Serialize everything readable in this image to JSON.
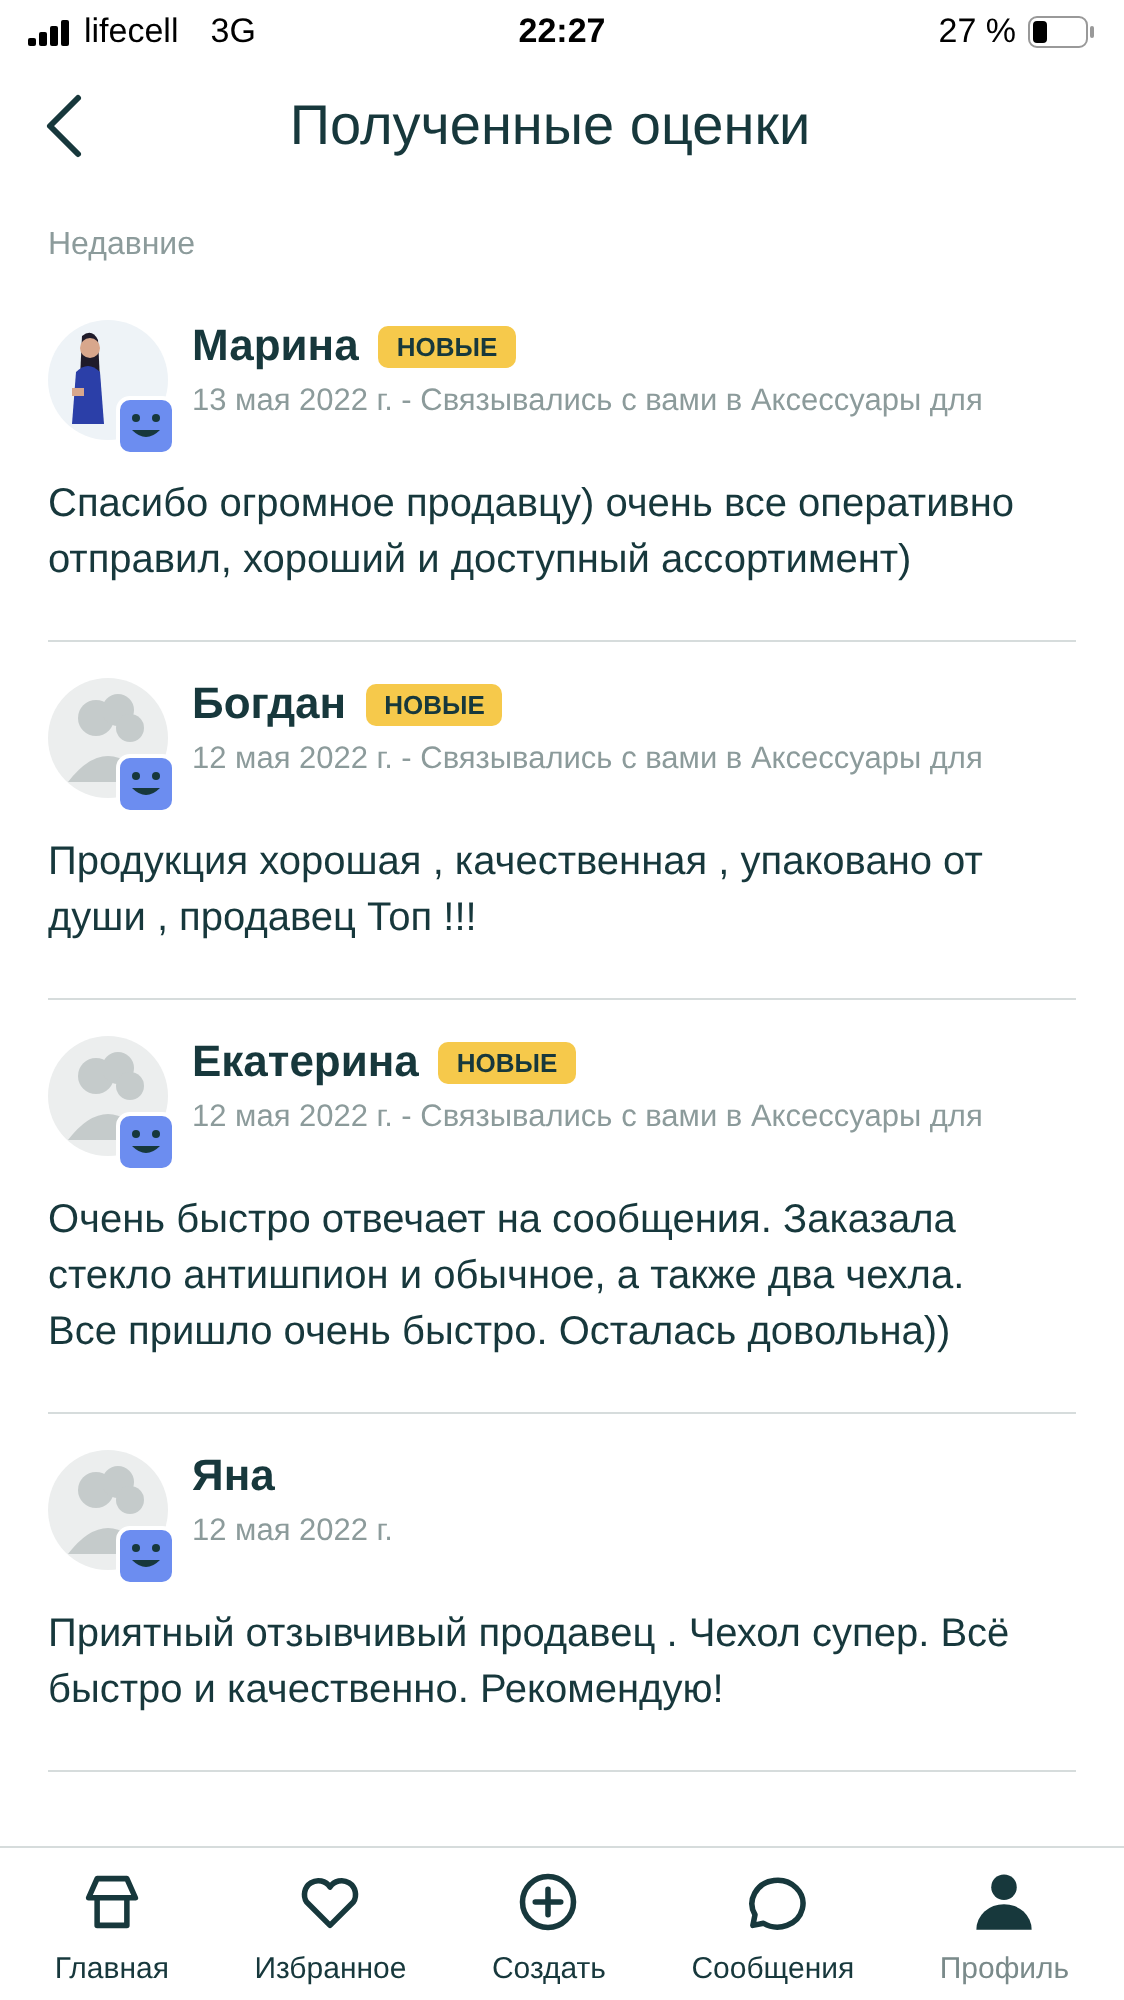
{
  "status_bar": {
    "carrier": "lifecell",
    "network": "3G",
    "time": "22:27",
    "battery": "27 %"
  },
  "header": {
    "title": "Полученные оценки"
  },
  "section": "Недавние",
  "reviews": [
    {
      "name": "Марина",
      "badge": "НОВЫЕ",
      "meta": "13 мая 2022 г. - Связывались с вами в Аксессуары для",
      "text": "Спасибо огромное продавцу) очень все оперативно отправил, хороший и доступный ассортимент)"
    },
    {
      "kind": "default",
      "name": "Богдан",
      "badge": "НОВЫЕ",
      "meta": "12 мая 2022 г. - Связывались с вами в Аксессуары для",
      "text": "Продукция хорошая , качественная , упаковано от души , продавец Топ !!!"
    },
    {
      "kind": "default",
      "name": "Екатерина",
      "badge": "НОВЫЕ",
      "meta": "12 мая 2022 г. - Связывались с вами в Аксессуары для",
      "text": "Очень быстро отвечает на сообщения. Заказала стекло антишпион и обычное, а также два чехла. Все пришло очень быстро. Осталась довольна))"
    },
    {
      "kind": "default",
      "name": "Яна",
      "meta": "12 мая 2022 г.",
      "text": "Приятный отзывчивый продавец . Чехол супер. Всё быстро и качественно. Рекомендую!"
    }
  ],
  "nav": [
    {
      "label": "Главная",
      "selected": false
    },
    {
      "label": "Избранное",
      "selected": false
    },
    {
      "label": "Создать",
      "selected": false
    },
    {
      "label": "Сообщения",
      "selected": false
    },
    {
      "label": "Профиль",
      "selected": true
    }
  ]
}
